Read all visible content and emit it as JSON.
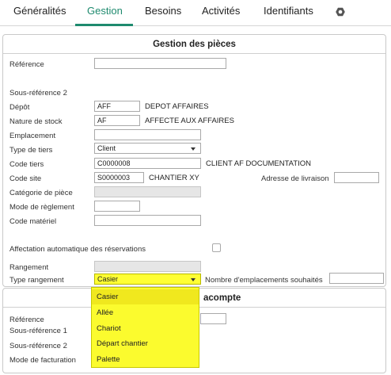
{
  "tabs": [
    {
      "label": "Généralités"
    },
    {
      "label": "Gestion"
    },
    {
      "label": "Besoins"
    },
    {
      "label": "Activités"
    },
    {
      "label": "Identifiants"
    }
  ],
  "panel1": {
    "title": "Gestion des pièces",
    "fields": {
      "reference": {
        "label": "Référence",
        "value": ""
      },
      "sous_reference_2": {
        "label": "Sous-référence 2"
      },
      "depot": {
        "label": "Dépôt",
        "code": "AFF",
        "description": "DEPOT AFFAIRES"
      },
      "nature_stock": {
        "label": "Nature de stock",
        "code": "AF",
        "description": "AFFECTE AUX AFFAIRES"
      },
      "emplacement": {
        "label": "Emplacement",
        "value": ""
      },
      "type_tiers": {
        "label": "Type de tiers",
        "value": "Client"
      },
      "code_tiers": {
        "label": "Code tiers",
        "code": "C0000008",
        "description": "CLIENT AF  DOCUMENTATION"
      },
      "code_site": {
        "label": "Code site",
        "code": "S0000003",
        "description": "CHANTIER XY"
      },
      "adresse_livraison": {
        "label": "Adresse de livraison",
        "value": ""
      },
      "categorie_piece": {
        "label": "Catégorie de pièce",
        "value": ""
      },
      "mode_reglement": {
        "label": "Mode de règlement",
        "value": ""
      },
      "code_materiel": {
        "label": "Code matériel",
        "value": ""
      },
      "affectation_auto": {
        "label": "Affectation automatique des réservations",
        "checked": false
      },
      "rangement": {
        "label": "Rangement",
        "value": ""
      },
      "type_rangement": {
        "label": "Type rangement",
        "value": "Casier"
      },
      "nb_emplacements": {
        "label": "Nombre d'emplacements souhaités",
        "value": ""
      }
    }
  },
  "panel2": {
    "title_suffix": "acompte",
    "fields": {
      "reference": {
        "label": "Référence",
        "value": ""
      },
      "sous_reference_1": {
        "label": "Sous-référence 1"
      },
      "sous_reference_2": {
        "label": "Sous-référence 2"
      },
      "mode_facturation": {
        "label": "Mode de facturation"
      }
    }
  },
  "dropdown": {
    "options": [
      "Casier",
      "Allée",
      "Chariot",
      "Départ chantier",
      "Palette"
    ],
    "selected": "Casier"
  },
  "colors": {
    "accent": "#1e8a6e",
    "highlight": "#ffff33",
    "disabled": "#e6e6e6"
  }
}
